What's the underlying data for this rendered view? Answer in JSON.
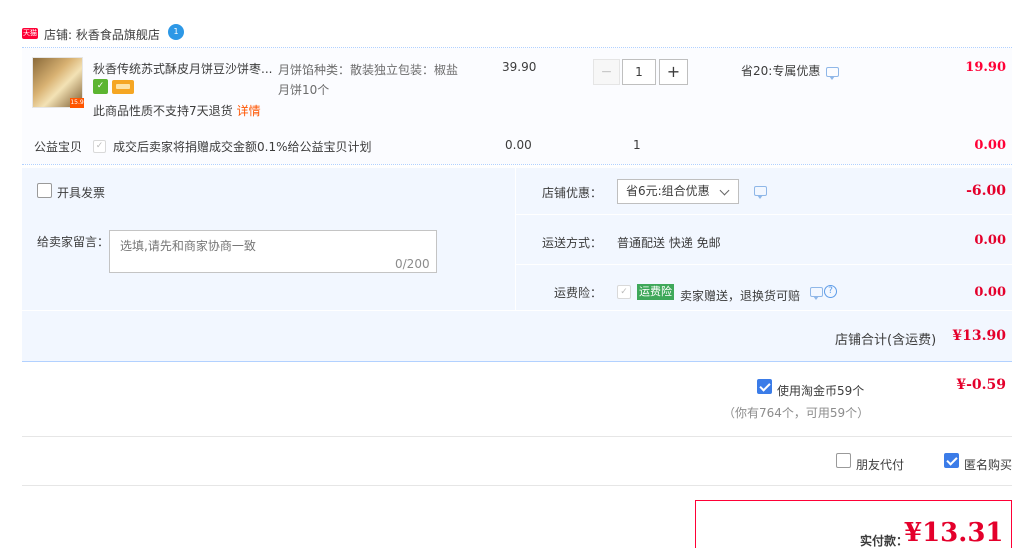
{
  "shop": {
    "badge": "天猫",
    "label": "店铺: 秋香食品旗舰店",
    "ww": "1"
  },
  "item": {
    "title": "秋香传统苏式酥皮月饼豆沙饼枣...",
    "thumb_tag": "15.9",
    "no_return": "此商品性质不支持7天退货",
    "detail_link": "详情",
    "sku_line1": "月饼馅种类：散装独立包装：椒盐",
    "sku_line2": "月饼10个",
    "price": "39.90",
    "qty_minus": "−",
    "qty": "1",
    "qty_plus": "+",
    "promo": "省20:专属优惠",
    "total": "19.90"
  },
  "charity": {
    "label": "公益宝贝",
    "text": "成交后卖家将捐赠成交金额0.1%给公益宝贝计划",
    "price": "0.00",
    "qty": "1",
    "total": "0.00"
  },
  "options": {
    "invoice_label": "开具发票",
    "message_label": "给卖家留言：",
    "message_placeholder": "选填,请先和商家协商一致",
    "message_count": "0/200",
    "shop_promo_label": "店铺优惠：",
    "shop_promo_selected": "省6元:组合优惠",
    "shop_promo_amount": "-6.00",
    "shipping_label": "运送方式：",
    "shipping_value": "普通配送 快递 免邮",
    "shipping_amount": "0.00",
    "insurance_label": "运费险：",
    "insurance_badge": "运费险",
    "insurance_text": "卖家赠送，退换货可赔",
    "insurance_amount": "0.00",
    "shop_total_label": "店铺合计(含运费)",
    "shop_total_amount": "¥13.90"
  },
  "coins": {
    "label": "使用淘金币59个",
    "amount": "¥-0.59",
    "note": "（你有764个，可用59个）"
  },
  "footer": {
    "friend_pay_label": "朋友代付",
    "anonymous_label": "匿名购买",
    "pay_label": "实付款：",
    "pay_amount": "¥13.31"
  },
  "colors": {
    "accent_red": "#ff0036",
    "panel_bg": "#f2f7ff",
    "checkbox_blue": "#3b7ce8",
    "insurance_green": "#3fa85a"
  }
}
